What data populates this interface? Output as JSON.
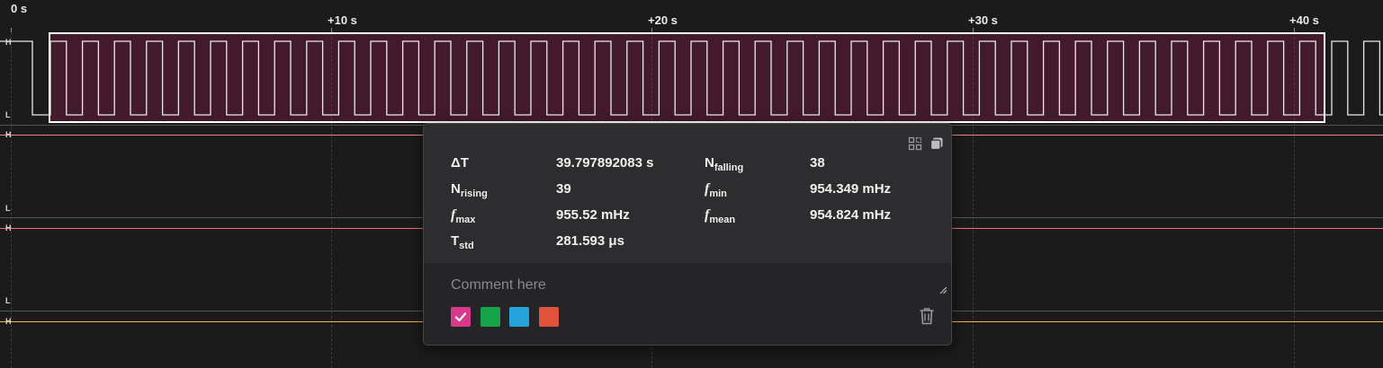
{
  "timeline": {
    "ticks": [
      "0 s",
      "+10 s",
      "+20 s",
      "+30 s",
      "+40 s"
    ]
  },
  "channels": [
    {
      "high": "H",
      "low": "L",
      "color": "#ffffff"
    },
    {
      "high": "H",
      "low": "L",
      "color": "#e88a8a"
    },
    {
      "high": "H",
      "low": "L",
      "color": "#f06c7a"
    },
    {
      "high": "H",
      "low": "",
      "color": "#f5b544"
    }
  ],
  "selection": {
    "color": "#c2185b"
  },
  "measurement": {
    "delta_t_label": "ΔT",
    "delta_t_value": "39.797892083 s",
    "n_falling_base": "N",
    "n_falling_sub": "falling",
    "n_falling_value": "38",
    "n_rising_base": "N",
    "n_rising_sub": "rising",
    "n_rising_value": "39",
    "f_min_base": "f",
    "f_min_sub": "min",
    "f_min_value": "954.349 mHz",
    "f_max_base": "f",
    "f_max_sub": "max",
    "f_max_value": "955.52 mHz",
    "f_mean_base": "f",
    "f_mean_sub": "mean",
    "f_mean_value": "954.824 mHz",
    "t_std_base": "T",
    "t_std_sub": "std",
    "t_std_value": "281.593 μs"
  },
  "comment": {
    "placeholder": "Comment here",
    "value": ""
  },
  "swatches": [
    {
      "color": "#d63a8a",
      "selected": true
    },
    {
      "color": "#17a34a",
      "selected": false
    },
    {
      "color": "#26a3db",
      "selected": false
    },
    {
      "color": "#e0533a",
      "selected": false
    }
  ]
}
